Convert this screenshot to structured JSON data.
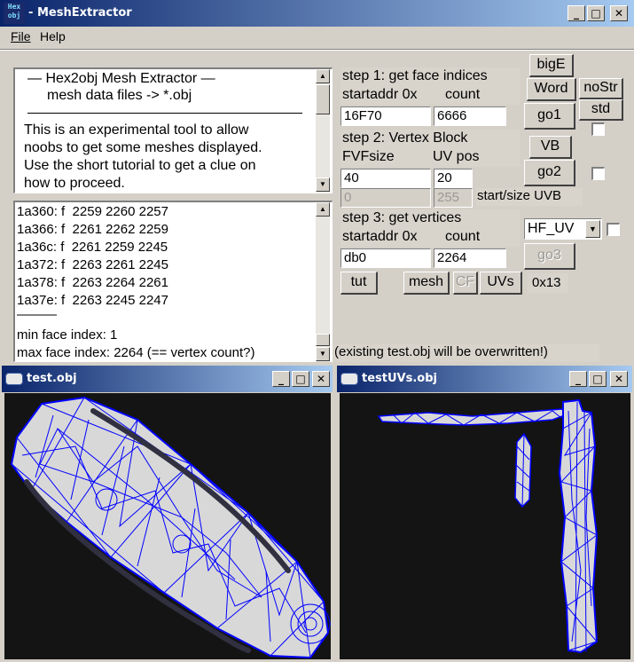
{
  "main_window": {
    "app_icon_text": "Hex obj",
    "title": "MeshExtractor",
    "title_prefix": "-",
    "buttons": {
      "minimize": "_",
      "maximize": "□",
      "close": "✕"
    }
  },
  "menu": {
    "file": "File",
    "help": "Help"
  },
  "info_panel": {
    "line1": "—   Hex2obj Mesh Extractor   —",
    "line2": "mesh data files -> *.obj",
    "line3": "This is an experimental tool to allow",
    "line4": "noobs to get some meshes displayed.",
    "line5": "Use the short tutorial to get a clue on",
    "line6": "how to proceed."
  },
  "log_panel": {
    "lines": [
      "1a360: f  2259 2260 2257",
      "1a366: f  2261 2262 2259",
      "1a36c: f  2261 2259 2245",
      "1a372: f  2263 2261 2245",
      "1a378: f  2263 2264 2261",
      "1a37e: f  2263 2245 2247"
    ],
    "separator": "———",
    "min_line": "min face index: 1",
    "max_line": "max face index: 2264 (== vertex count?)"
  },
  "step1": {
    "title": "step 1: get face indices",
    "startaddr_label": "startaddr 0x",
    "count_label": "count",
    "startaddr_value": "16F70",
    "count_value": "6666",
    "go_button": "go1"
  },
  "step2": {
    "title": "step 2: Vertex Block",
    "fvf_label": "FVFsize",
    "uvpos_label": "UV pos",
    "fvf_value": "40",
    "uvpos_value": "20",
    "uvb_start_value": "0",
    "uvb_size_value": "255",
    "uvb_label": "start/size UVB",
    "vb_button": "VB",
    "go_button": "go2"
  },
  "step3": {
    "title": "step 3: get vertices",
    "startaddr_label": "startaddr 0x",
    "count_label": "count",
    "startaddr_value": "db0",
    "count_value": "2264",
    "go_button": "go3",
    "uv_mode": "HF_UV"
  },
  "side_buttons": {
    "bigE": "bigE",
    "word": "Word",
    "nostr": "noStr",
    "std": "std"
  },
  "bottom_buttons": {
    "tut": "tut",
    "mesh": "mesh",
    "cf": "CF",
    "uvs": "UVs",
    "hex_label": "0x13"
  },
  "warning_text": "(existing test.obj will be overwritten!)",
  "viewer_left": {
    "title": "test.obj"
  },
  "viewer_right": {
    "title": "testUVs.obj"
  },
  "colors": {
    "titlebar_start": "#0a246a",
    "titlebar_end": "#a6caf0",
    "viewer_bg": "#141414",
    "mesh_fill": "#d8d8d8",
    "wire": "#0000ff"
  }
}
